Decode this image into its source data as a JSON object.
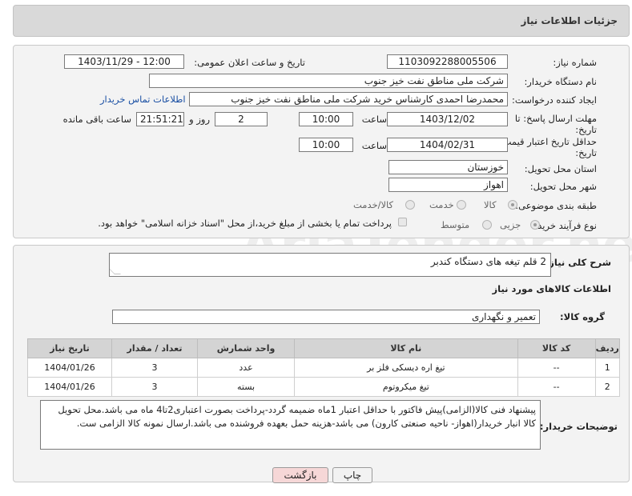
{
  "header": {
    "title": "جزئیات اطلاعات نیاز"
  },
  "form": {
    "need_number_label": "شماره نیاز:",
    "need_number": "1103092288005506",
    "announce_label": "تاریخ و ساعت اعلان عمومی:",
    "announce_value": "1403/11/29 - 12:00",
    "buyer_org_label": "نام دستگاه خریدار:",
    "buyer_org": "شرکت ملی مناطق نفت خیز جنوب",
    "creator_label": "ایجاد کننده درخواست:",
    "creator": "محمدرضا احمدی  کارشناس خرید  شرکت ملی مناطق نفت خیز جنوب",
    "contact_link": "اطلاعات تماس خریدار",
    "deadline_label_1": "مهلت ارسال پاسخ: تا",
    "deadline_label_2": "تاریخ:",
    "deadline_date": "1403/12/02",
    "time_label": "ساعت",
    "deadline_time": "10:00",
    "days_value": "2",
    "days_label": "روز و",
    "remaining_time": "21:51:21",
    "remaining_label": "ساعت باقی مانده",
    "validity_label_1": "حداقل تاریخ اعتبار قیمت: تا",
    "validity_label_2": "تاریخ:",
    "validity_date": "1404/02/31",
    "validity_time": "10:00",
    "province_label": "استان محل تحویل:",
    "province": "خوزستان",
    "city_label": "شهر محل تحویل:",
    "city": "اهواز",
    "category_label": "طبقه بندی موضوعی:",
    "category_options": [
      "کالا",
      "خدمت",
      "کالا/خدمت"
    ],
    "process_label": "نوع فرآیند خرید :",
    "process_options": [
      "جزیی",
      "متوسط"
    ],
    "payment_note": "پرداخت تمام یا بخشی از مبلغ خرید،از محل \"اسناد خزانه اسلامی\" خواهد بود."
  },
  "summary": {
    "label": "شرح کلی نیاز:",
    "value": "2 قلم تیغه های دستگاه کندبر"
  },
  "goods": {
    "section_title": "اطلاعات کالاهای مورد نیاز",
    "group_label": "گروه کالا:",
    "group_value": "تعمیر و نگهداری"
  },
  "table": {
    "headers": [
      "ردیف",
      "کد کالا",
      "نام کالا",
      "واحد شمارش",
      "تعداد / مقدار",
      "تاریخ نیاز"
    ],
    "rows": [
      [
        "1",
        "--",
        "تیغ اره دیسکی فلز بر",
        "عدد",
        "3",
        "1404/01/26"
      ],
      [
        "2",
        "--",
        "تیغ میکروتوم",
        "بسته",
        "3",
        "1404/01/26"
      ]
    ]
  },
  "notes": {
    "label": "توضیحات خریدار:",
    "text": "پیشنهاد فنی کالا(الزامی)پیش فاکتور با حداقل اعتبار 1ماه ضمیمه گردد-پرداخت بصورت اعتباری2تا4 ماه می باشد.محل تحویل کالا انبار خریدار(اهواز- ناحیه صنعتی کارون) می باشد-هزینه حمل بعهده فروشنده می باشد.ارسال نمونه کالا الزامی ست."
  },
  "buttons": {
    "print": "چاپ",
    "back": "بازگشت"
  },
  "colors": {
    "link": "#1a4fa3",
    "back_button_bg": "#f6d7d7",
    "header_bg": "#d9d9d9"
  }
}
